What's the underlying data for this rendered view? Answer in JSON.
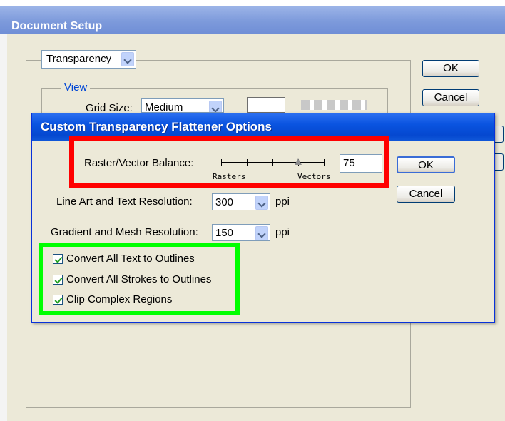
{
  "document_setup": {
    "title": "Document Setup",
    "category_select": "Transparency",
    "view_group_label": "View",
    "grid_size_label": "Grid Size:",
    "grid_size_value": "Medium",
    "ok_label": "OK",
    "cancel_label": "Cancel"
  },
  "flattener_dialog": {
    "title": "Custom Transparency Flattener Options",
    "raster_vector_label": "Raster/Vector Balance:",
    "slider_left_label": "Rasters",
    "slider_right_label": "Vectors",
    "slider_value": 75,
    "balance_input_value": "75",
    "line_art_label": "Line Art and Text Resolution:",
    "line_art_value": "300",
    "gradient_mesh_label": "Gradient and Mesh Resolution:",
    "gradient_mesh_value": "150",
    "unit_label": "ppi",
    "checkboxes": [
      {
        "label": "Convert All Text to Outlines",
        "checked": true
      },
      {
        "label": "Convert All Strokes to Outlines",
        "checked": true
      },
      {
        "label": "Clip Complex Regions",
        "checked": true
      }
    ],
    "ok_label": "OK",
    "cancel_label": "Cancel"
  },
  "annotations": {
    "red_highlight_color": "#ff0000",
    "green_highlight_color": "#00ff00"
  }
}
